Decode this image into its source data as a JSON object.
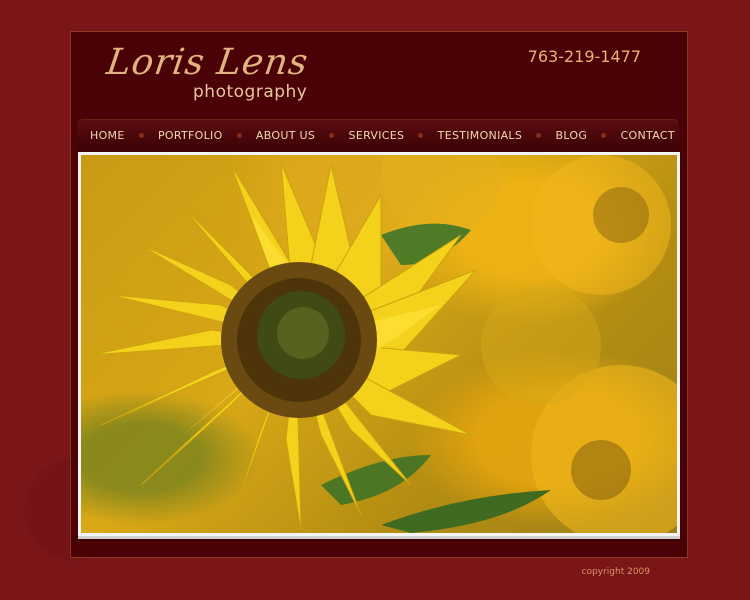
{
  "header": {
    "logo_script": "Loris Lens",
    "logo_sub": "photography",
    "phone": "763-219-1477"
  },
  "nav": {
    "items": [
      {
        "label": "HOME"
      },
      {
        "label": "PORTFOLIO"
      },
      {
        "label": "ABOUT US"
      },
      {
        "label": "SERVICES"
      },
      {
        "label": "TESTIMONIALS"
      },
      {
        "label": "BLOG"
      },
      {
        "label": "CONTACT"
      }
    ]
  },
  "hero": {
    "image_subject": "sunflower"
  },
  "footer": {
    "copyright": "copyright 2009"
  },
  "colors": {
    "background": "#7a1518",
    "panel": "#4a0206",
    "accent": "#eab179",
    "nav_text": "#f0d9b5"
  }
}
